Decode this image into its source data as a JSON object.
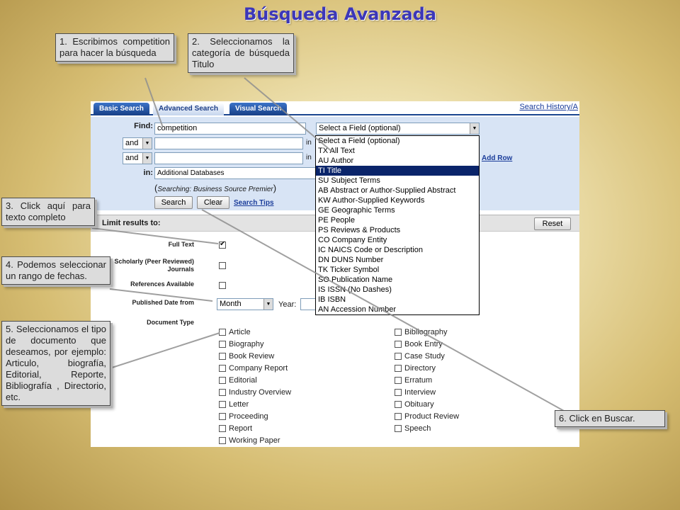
{
  "title": "Búsqueda Avanzada",
  "tabs": [
    "Basic Search",
    "Advanced Search",
    "Visual Search"
  ],
  "history_link": "Search History/A",
  "find": {
    "label": "Find:",
    "value": "competition",
    "field_select": "Select a Field (optional)",
    "bool_1": "and",
    "bool_2": "and",
    "in_label": "in",
    "add_row": "Add Row",
    "databases_label": "in:",
    "databases_value": "Additional Databases",
    "searching_prefix": "Searching:",
    "searching_db": "Business Source Premier",
    "search_button": "Search",
    "clear_button": "Clear",
    "search_tips": "Search Tips"
  },
  "limit": {
    "heading": "Limit results to:",
    "reset_button": "Reset",
    "full_text_label": "Full Text",
    "full_text_checked": true,
    "scholarly_label_1": "Scholarly (Peer Reviewed)",
    "scholarly_label_2": "Journals",
    "references_label": "References Available",
    "published_label": "Published Date from",
    "month_value": "Month",
    "year_label": "Year:",
    "doctype_label": "Document Type",
    "doc_types_left": [
      "Article",
      "Biography",
      "Book Review",
      "Company Report",
      "Editorial",
      "Industry Overview",
      "Letter",
      "Proceeding",
      "Report",
      "Working Paper"
    ],
    "doc_types_right": [
      "Bibliography",
      "Book Entry",
      "Case Study",
      "Directory",
      "Erratum",
      "Interview",
      "Obituary",
      "Product Review",
      "Speech"
    ]
  },
  "dropdown_options": [
    "Select a Field (optional)",
    "TX All Text",
    "AU Author",
    "TI Title",
    "SU Subject Terms",
    "AB Abstract or Author-Supplied Abstract",
    "KW Author-Supplied Keywords",
    "GE Geographic Terms",
    "PE People",
    "PS Reviews & Products",
    "CO Company Entity",
    "IC NAICS Code or Description",
    "DN DUNS Number",
    "TK Ticker Symbol",
    "SO Publication Name",
    "IS ISSN (No Dashes)",
    "IB ISBN",
    "AN Accession Number"
  ],
  "dropdown_selected": "TI Title",
  "callouts": {
    "c1": "1. Escribimos competition para hacer la búsqueda",
    "c2": "2. Seleccionamos la categoría de búsqueda Titulo",
    "c3": "3. Click aquí para texto completo",
    "c4": "4. Podemos seleccionar un rango de fechas.",
    "c5": "5. Seleccionamos el tipo de documento que deseamos, por ejemplo: Articulo, biografía, Editorial, Reporte, Bibliografía , Directorio, etc.",
    "c6": "6. Click en Buscar."
  }
}
